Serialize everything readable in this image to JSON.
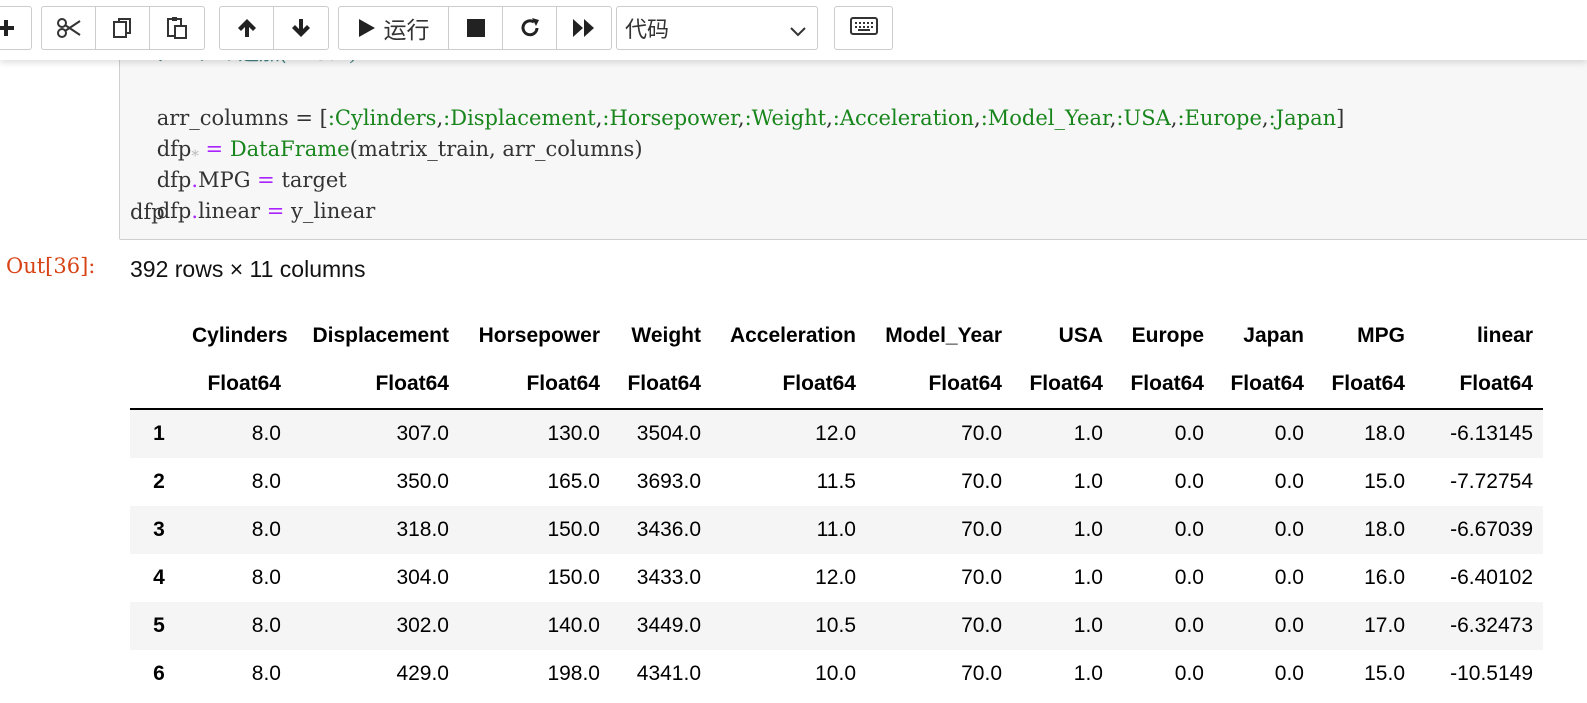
{
  "toolbar": {
    "run_label": "运行",
    "cell_type": "代码"
  },
  "code": {
    "line0": "# データの追加(linear)",
    "line1": {
      "pre": "arr_columns = [",
      "syms": [
        ":Cylinders",
        ":Displacement",
        ":Horsepower",
        ":Weight",
        ":Acceleration",
        ":Model_Year",
        ":USA",
        ":Europe",
        ":Japan"
      ],
      "post": "]"
    },
    "line2": {
      "a": "dfp",
      "b": " = ",
      "c": "DataFrame",
      "d": "(matrix_train, arr_columns)"
    },
    "line3": {
      "a": "dfp",
      "b": ".",
      "c": "MPG ",
      "d": "=",
      "e": " target"
    },
    "line4": {
      "a": "dfp",
      "b": ".",
      "c": "linear ",
      "d": "=",
      "e": " y_linear"
    },
    "line5": "dfp"
  },
  "output": {
    "prompt": "Out[36]:",
    "summary": "392 rows × 11 columns"
  },
  "table": {
    "columns": [
      "Cylinders",
      "Displacement",
      "Horsepower",
      "Weight",
      "Acceleration",
      "Model_Year",
      "USA",
      "Europe",
      "Japan",
      "MPG",
      "linear"
    ],
    "types": [
      "Float64",
      "Float64",
      "Float64",
      "Float64",
      "Float64",
      "Float64",
      "Float64",
      "Float64",
      "Float64",
      "Float64",
      "Float64"
    ],
    "rows": [
      [
        "1",
        "8.0",
        "307.0",
        "130.0",
        "3504.0",
        "12.0",
        "70.0",
        "1.0",
        "0.0",
        "0.0",
        "18.0",
        "-6.13145"
      ],
      [
        "2",
        "8.0",
        "350.0",
        "165.0",
        "3693.0",
        "11.5",
        "70.0",
        "1.0",
        "0.0",
        "0.0",
        "15.0",
        "-7.72754"
      ],
      [
        "3",
        "8.0",
        "318.0",
        "150.0",
        "3436.0",
        "11.0",
        "70.0",
        "1.0",
        "0.0",
        "0.0",
        "18.0",
        "-6.67039"
      ],
      [
        "4",
        "8.0",
        "304.0",
        "150.0",
        "3433.0",
        "12.0",
        "70.0",
        "1.0",
        "0.0",
        "0.0",
        "16.0",
        "-6.40102"
      ],
      [
        "5",
        "8.0",
        "302.0",
        "140.0",
        "3449.0",
        "10.5",
        "70.0",
        "1.0",
        "0.0",
        "0.0",
        "17.0",
        "-6.32473"
      ],
      [
        "6",
        "8.0",
        "429.0",
        "198.0",
        "4341.0",
        "10.0",
        "70.0",
        "1.0",
        "0.0",
        "0.0",
        "15.0",
        "-10.5149"
      ]
    ]
  }
}
